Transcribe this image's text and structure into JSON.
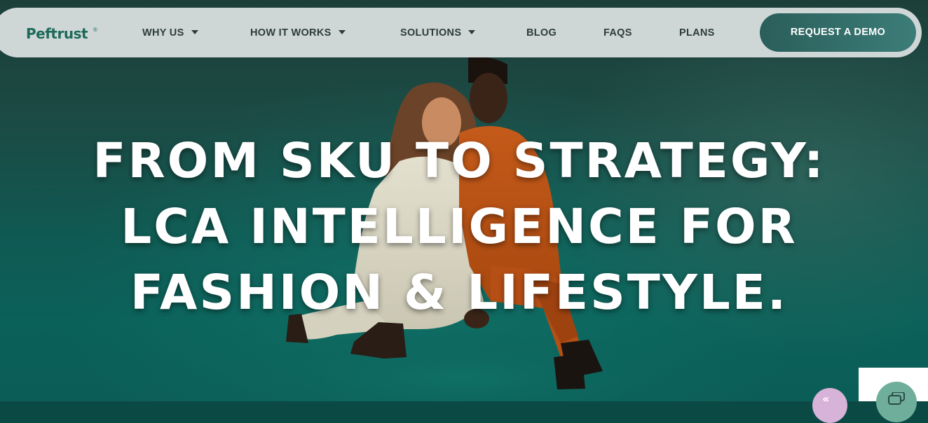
{
  "nav": {
    "logo": "Peftrust",
    "logo_mark": "®",
    "items": [
      {
        "label": "WHY US",
        "has_dropdown": true
      },
      {
        "label": "HOW IT WORKS",
        "has_dropdown": true
      },
      {
        "label": "SOLUTIONS",
        "has_dropdown": true
      },
      {
        "label": "BLOG",
        "has_dropdown": false
      },
      {
        "label": "FAQS",
        "has_dropdown": false
      },
      {
        "label": "PLANS",
        "has_dropdown": false
      }
    ],
    "cta_label": "REQUEST A DEMO"
  },
  "hero": {
    "headline_lines": [
      "FROM SKU TO STRATEGY:",
      "LCA INTELLIGENCE FOR",
      "FASHION & LIFESTYLE."
    ],
    "image": "two fashion models seated on teal backdrop, one in cream suit and one in orange suit"
  },
  "widgets": {
    "chat_icon": "chat-icon",
    "purple_icon": "quote-icon",
    "purple_glyph": "«"
  },
  "colors": {
    "nav_bg": "#cfd7d6",
    "brand": "#1d6a5a",
    "cta_bg": "#2f6a65",
    "hero_bg": "#0b5e57",
    "headline": "#ffffff"
  }
}
